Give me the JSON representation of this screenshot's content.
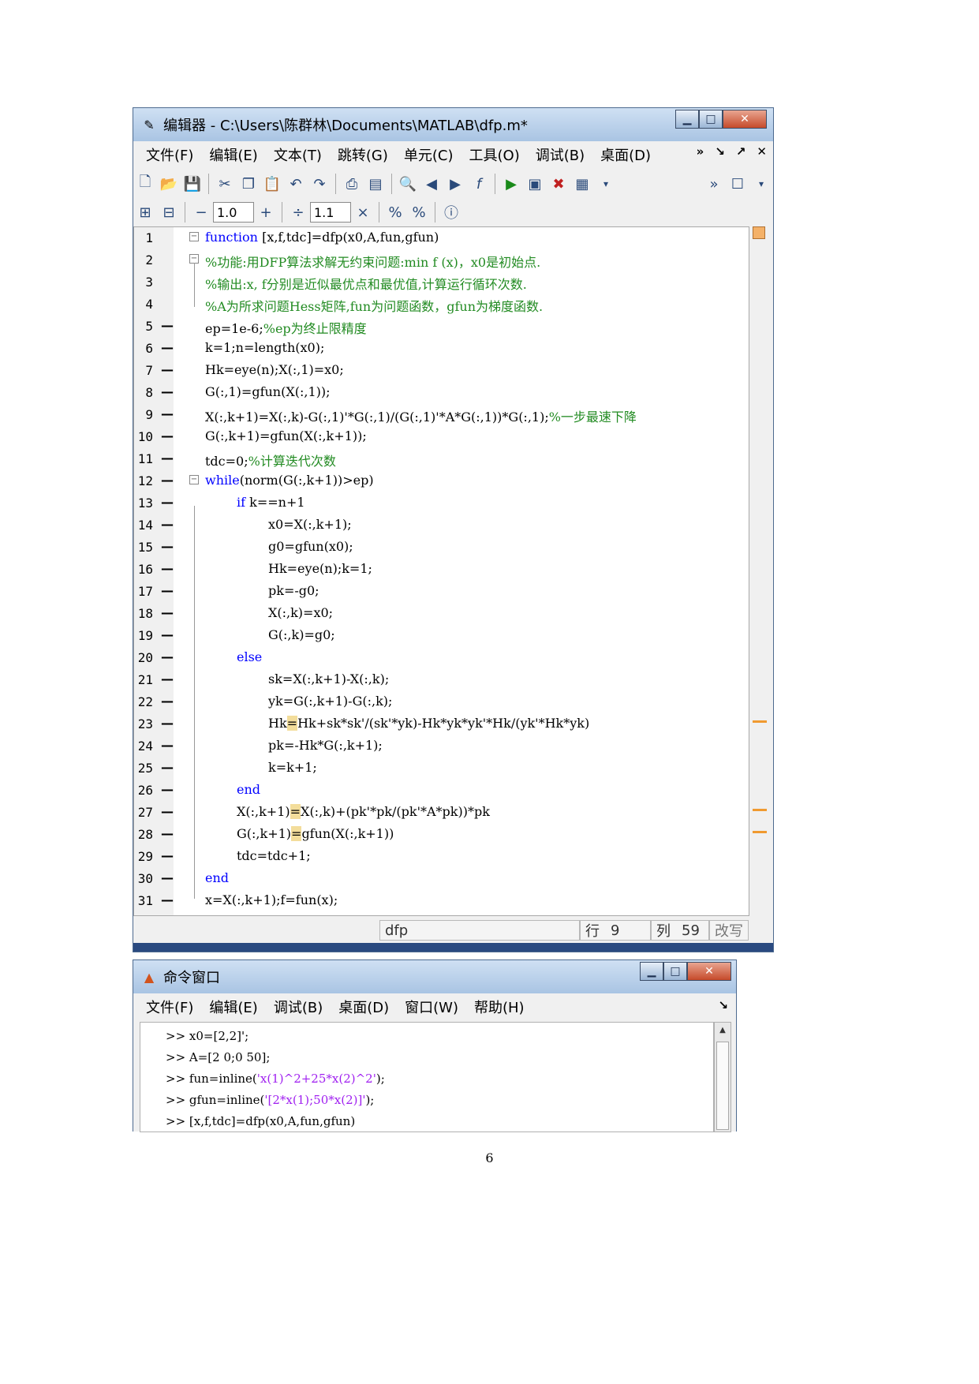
{
  "editor": {
    "title": "编辑器 - C:\\Users\\陈群林\\Documents\\MATLAB\\dfp.m*",
    "menu": [
      "文件(F)",
      "编辑(E)",
      "文本(T)",
      "跳转(G)",
      "单元(C)",
      "工具(O)",
      "调试(B)",
      "桌面(D)"
    ],
    "menu_right": [
      "»",
      "↘",
      "↗",
      "✕"
    ],
    "toolbar2": {
      "minus": "−",
      "value1": "1.0",
      "plus": "+",
      "divide": "÷",
      "value2": "1.1",
      "times": "×"
    },
    "lines": [
      {
        "n": "1",
        "dash": "",
        "indent": 0,
        "parts": [
          {
            "t": "function",
            "c": "kw"
          },
          {
            "t": " [x,f,tdc]=dfp(x0,A,fun,gfun)",
            "c": ""
          }
        ]
      },
      {
        "n": "2",
        "dash": "",
        "indent": 0,
        "parts": [
          {
            "t": "%功能:用DFP算法求解无约束问题:min f (x)，x0是初始点.",
            "c": "cm"
          }
        ]
      },
      {
        "n": "3",
        "dash": "",
        "indent": 0,
        "parts": [
          {
            "t": "%输出:x, f分别是近似最优点和最优值,计算运行循环次数.",
            "c": "cm"
          }
        ]
      },
      {
        "n": "4",
        "dash": "",
        "indent": 0,
        "parts": [
          {
            "t": "%A为所求问题Hess矩阵,fun为问题函数，gfun为梯度函数.",
            "c": "cm"
          }
        ]
      },
      {
        "n": "5",
        "dash": "—",
        "indent": 0,
        "parts": [
          {
            "t": "ep=1e-6;",
            "c": ""
          },
          {
            "t": "%ep为终止限精度",
            "c": "cm"
          }
        ]
      },
      {
        "n": "6",
        "dash": "—",
        "indent": 0,
        "parts": [
          {
            "t": "k=1;n=length(x0);",
            "c": ""
          }
        ]
      },
      {
        "n": "7",
        "dash": "—",
        "indent": 0,
        "parts": [
          {
            "t": "Hk=eye(n);X(:,1)=x0;",
            "c": ""
          }
        ]
      },
      {
        "n": "8",
        "dash": "—",
        "indent": 0,
        "parts": [
          {
            "t": "G(:,1)=gfun(X(:,1));",
            "c": ""
          }
        ]
      },
      {
        "n": "9",
        "dash": "—",
        "indent": 0,
        "parts": [
          {
            "t": "X(:,k+1)=X(:,k)-G(:,1)'*G(:,1)/(G(:,1)'*A*G(:,1))*G(:,1);",
            "c": ""
          },
          {
            "t": "%一步最速下降",
            "c": "cm"
          }
        ]
      },
      {
        "n": "10",
        "dash": "—",
        "indent": 0,
        "parts": [
          {
            "t": "G(:,k+1)=gfun(X(:,k+1));",
            "c": ""
          }
        ]
      },
      {
        "n": "11",
        "dash": "—",
        "indent": 0,
        "parts": [
          {
            "t": "tdc=0;",
            "c": ""
          },
          {
            "t": "%计算迭代次数",
            "c": "cm"
          }
        ]
      },
      {
        "n": "12",
        "dash": "—",
        "indent": 0,
        "parts": [
          {
            "t": "while",
            "c": "kw"
          },
          {
            "t": "(norm(G(:,k+1))>ep)",
            "c": ""
          }
        ]
      },
      {
        "n": "13",
        "dash": "—",
        "indent": 1,
        "parts": [
          {
            "t": "if",
            "c": "kw"
          },
          {
            "t": " k==n+1",
            "c": ""
          }
        ]
      },
      {
        "n": "14",
        "dash": "—",
        "indent": 2,
        "parts": [
          {
            "t": "x0=X(:,k+1);",
            "c": ""
          }
        ]
      },
      {
        "n": "15",
        "dash": "—",
        "indent": 2,
        "parts": [
          {
            "t": "g0=gfun(x0);",
            "c": ""
          }
        ]
      },
      {
        "n": "16",
        "dash": "—",
        "indent": 2,
        "parts": [
          {
            "t": "Hk=eye(n);k=1;",
            "c": ""
          }
        ]
      },
      {
        "n": "17",
        "dash": "—",
        "indent": 2,
        "parts": [
          {
            "t": "pk=-g0;",
            "c": ""
          }
        ]
      },
      {
        "n": "18",
        "dash": "—",
        "indent": 2,
        "parts": [
          {
            "t": "X(:,k)=x0;",
            "c": ""
          }
        ]
      },
      {
        "n": "19",
        "dash": "—",
        "indent": 2,
        "parts": [
          {
            "t": "G(:,k)=g0;",
            "c": ""
          }
        ]
      },
      {
        "n": "20",
        "dash": "—",
        "indent": 1,
        "parts": [
          {
            "t": "else",
            "c": "kw"
          }
        ]
      },
      {
        "n": "21",
        "dash": "—",
        "indent": 2,
        "parts": [
          {
            "t": "sk=X(:,k+1)-X(:,k);",
            "c": ""
          }
        ]
      },
      {
        "n": "22",
        "dash": "—",
        "indent": 2,
        "parts": [
          {
            "t": "yk=G(:,k+1)-G(:,k);",
            "c": ""
          }
        ]
      },
      {
        "n": "23",
        "dash": "—",
        "indent": 2,
        "parts": [
          {
            "t": "Hk",
            "c": ""
          },
          {
            "t": "=",
            "c": "hl"
          },
          {
            "t": "Hk+sk*sk'/(sk'*yk)-Hk*yk*yk'*Hk/(yk'*Hk*yk)",
            "c": ""
          }
        ]
      },
      {
        "n": "24",
        "dash": "—",
        "indent": 2,
        "parts": [
          {
            "t": "pk=-Hk*G(:,k+1);",
            "c": ""
          }
        ]
      },
      {
        "n": "25",
        "dash": "—",
        "indent": 2,
        "parts": [
          {
            "t": "k=k+1;",
            "c": ""
          }
        ]
      },
      {
        "n": "26",
        "dash": "—",
        "indent": 1,
        "parts": [
          {
            "t": "end",
            "c": "kw"
          }
        ]
      },
      {
        "n": "27",
        "dash": "—",
        "indent": 1,
        "parts": [
          {
            "t": "X(:,k+1)",
            "c": ""
          },
          {
            "t": "=",
            "c": "hl"
          },
          {
            "t": "X(:,k)+(pk'*pk/(pk'*A*pk))*pk",
            "c": ""
          }
        ]
      },
      {
        "n": "28",
        "dash": "—",
        "indent": 1,
        "parts": [
          {
            "t": "G(:,k+1)",
            "c": ""
          },
          {
            "t": "=",
            "c": "hl"
          },
          {
            "t": "gfun(X(:,k+1))",
            "c": ""
          }
        ]
      },
      {
        "n": "29",
        "dash": "—",
        "indent": 1,
        "parts": [
          {
            "t": "tdc=tdc+1;",
            "c": ""
          }
        ]
      },
      {
        "n": "30",
        "dash": "—",
        "indent": 0,
        "parts": [
          {
            "t": "end",
            "c": "kw"
          }
        ]
      },
      {
        "n": "31",
        "dash": "—",
        "indent": 0,
        "parts": [
          {
            "t": "x=X(:,k+1);f=fun(x);",
            "c": ""
          }
        ]
      }
    ],
    "status": {
      "file": "dfp",
      "row_label": "行",
      "row": "9",
      "col_label": "列",
      "col": "59",
      "mode": "改写"
    }
  },
  "command_window": {
    "title": "命令窗口",
    "menu": [
      "文件(F)",
      "编辑(E)",
      "调试(B)",
      "桌面(D)",
      "窗口(W)",
      "帮助(H)"
    ],
    "menu_right": "↘",
    "lines": [
      [
        {
          "t": ">> x0=[2,2]';",
          "c": ""
        }
      ],
      [
        {
          "t": ">> A=[2 0;0 50];",
          "c": ""
        }
      ],
      [
        {
          "t": ">> fun=inline(",
          "c": ""
        },
        {
          "t": "'x(1)^2+25*x(2)^2'",
          "c": "str"
        },
        {
          "t": ");",
          "c": ""
        }
      ],
      [
        {
          "t": ">> gfun=inline(",
          "c": ""
        },
        {
          "t": "'[2*x(1);50*x(2)]'",
          "c": "str"
        },
        {
          "t": ");",
          "c": ""
        }
      ],
      [
        {
          "t": ">> [x,f,tdc]=dfp(x0,A,fun,gfun)",
          "c": ""
        }
      ]
    ]
  },
  "page_number": "6",
  "colors": {
    "keyword": "#0000ff",
    "comment": "#228b22",
    "string": "#a020f0",
    "highlight": "#f3dd9b",
    "marker": "#f09a30"
  }
}
